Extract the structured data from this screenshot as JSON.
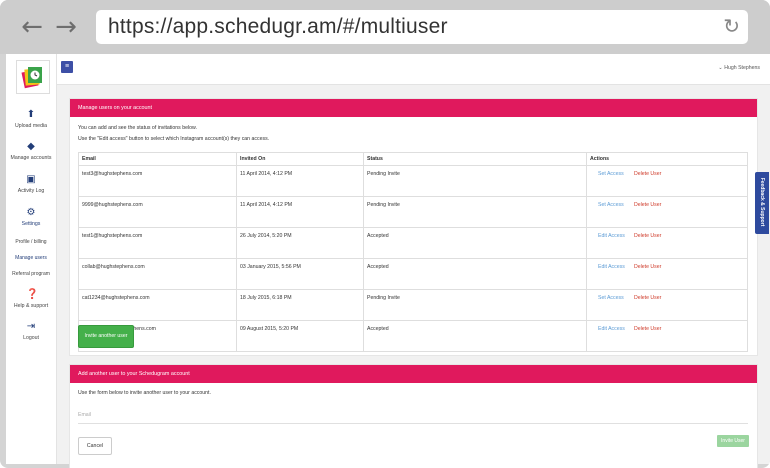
{
  "browser": {
    "url": "https://app.schedugr.am/#/multiuser"
  },
  "topbar": {
    "user_name": "Hugh Stephens"
  },
  "sidebar": {
    "items": [
      {
        "label": "Upload media",
        "icon": "upload-icon"
      },
      {
        "label": "Manage accounts",
        "icon": "layers-icon"
      },
      {
        "label": "Activity Log",
        "icon": "activity-icon"
      },
      {
        "label": "Settings",
        "icon": "gear-icon"
      }
    ],
    "subitems": [
      {
        "label": "Profile / billing"
      },
      {
        "label": "Manage users"
      },
      {
        "label": "Referral program"
      }
    ],
    "bottom_items": [
      {
        "label": "Help & support",
        "icon": "help-icon"
      },
      {
        "label": "Logout",
        "icon": "logout-icon"
      }
    ]
  },
  "manage_panel": {
    "title": "Manage users on your account",
    "line1": "You can add and see the status of invitations below.",
    "line2": "Use the \"Edit access\" button to select which Instagram account(s) they can access.",
    "columns": [
      "Email",
      "Invited On",
      "Status",
      "Actions"
    ],
    "rows": [
      {
        "email": "test3@hughstephens.com",
        "invited": "11 April 2014, 4:12 PM",
        "status": "Pending Invite",
        "access": "Set Access",
        "delete": "Delete User"
      },
      {
        "email": "9999@hughstephens.com",
        "invited": "11 April 2014, 4:12 PM",
        "status": "Pending Invite",
        "access": "Set Access",
        "delete": "Delete User"
      },
      {
        "email": "test1@hughstephens.com",
        "invited": "26 July 2014, 5:20 PM",
        "status": "Accepted",
        "access": "Edit Access",
        "delete": "Delete User"
      },
      {
        "email": "collab@hughstephens.com",
        "invited": "03 January 2015, 5:56 PM",
        "status": "Accepted",
        "access": "Edit Access",
        "delete": "Delete User"
      },
      {
        "email": "cat1234@hughstephens.com",
        "invited": "18 July 2015, 6:18 PM",
        "status": "Pending Invite",
        "access": "Set Access",
        "delete": "Delete User"
      },
      {
        "email": "fordropbox@hughstephens.com",
        "invited": "09 August 2015, 5:20 PM",
        "status": "Accepted",
        "access": "Edit Access",
        "delete": "Delete User"
      }
    ],
    "invite_button": "Invite another user"
  },
  "add_panel": {
    "title": "Add another user to your Schedugram account",
    "line1": "Use the form below to invite another user to your account.",
    "email_placeholder": "Email",
    "cancel_button": "Cancel",
    "invite_button": "Invite User"
  },
  "feedback_tab": "Feedback & Support",
  "colors": {
    "header_pink": "#e0195d",
    "nav_blue": "#223d78",
    "invite_green": "#44b04a",
    "link_blue": "#5b9bd5",
    "delete_red": "#cf3b2a"
  }
}
